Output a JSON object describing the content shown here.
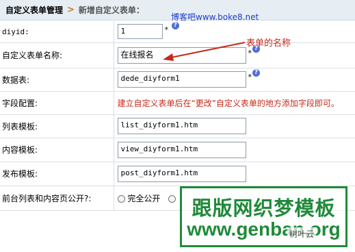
{
  "breadcrumb": {
    "root": "自定义表单管理",
    "separator": ">",
    "current": "新增自定义表单："
  },
  "watermark_top": "博客吧www.boke8.net",
  "annotation_text": "表单的名称",
  "required_mark": "*",
  "help_glyph": "?",
  "rows": {
    "diyid": {
      "label": "diyid:",
      "value": "1"
    },
    "name": {
      "label": "自定义表单名称:",
      "value": "在线报名"
    },
    "table": {
      "label": "数据表:",
      "value": "dede_diyform1"
    },
    "fields": {
      "label": "字段配置:",
      "note": "建立自定义表单后在“更改”自定义表单的地方添加字段即可。"
    },
    "list_tpl": {
      "label": "列表模板:",
      "value": "list_diyform1.htm"
    },
    "view_tpl": {
      "label": "内容模板:",
      "value": "view_diyform1.htm"
    },
    "post_tpl": {
      "label": "发布模板:",
      "value": "post_diyform1.htm"
    },
    "public": {
      "label": "前台列表和内容页公开?:",
      "option1": "完全公开"
    }
  },
  "overlay": {
    "logo_line1": "跟版网织梦模板",
    "logo_line2": "www.genban.org",
    "corner_mark": "树叶云"
  },
  "colors": {
    "accent_red": "#c62a18",
    "logo_green": "#1f8a3a",
    "link_blue": "#1e3cc8"
  }
}
